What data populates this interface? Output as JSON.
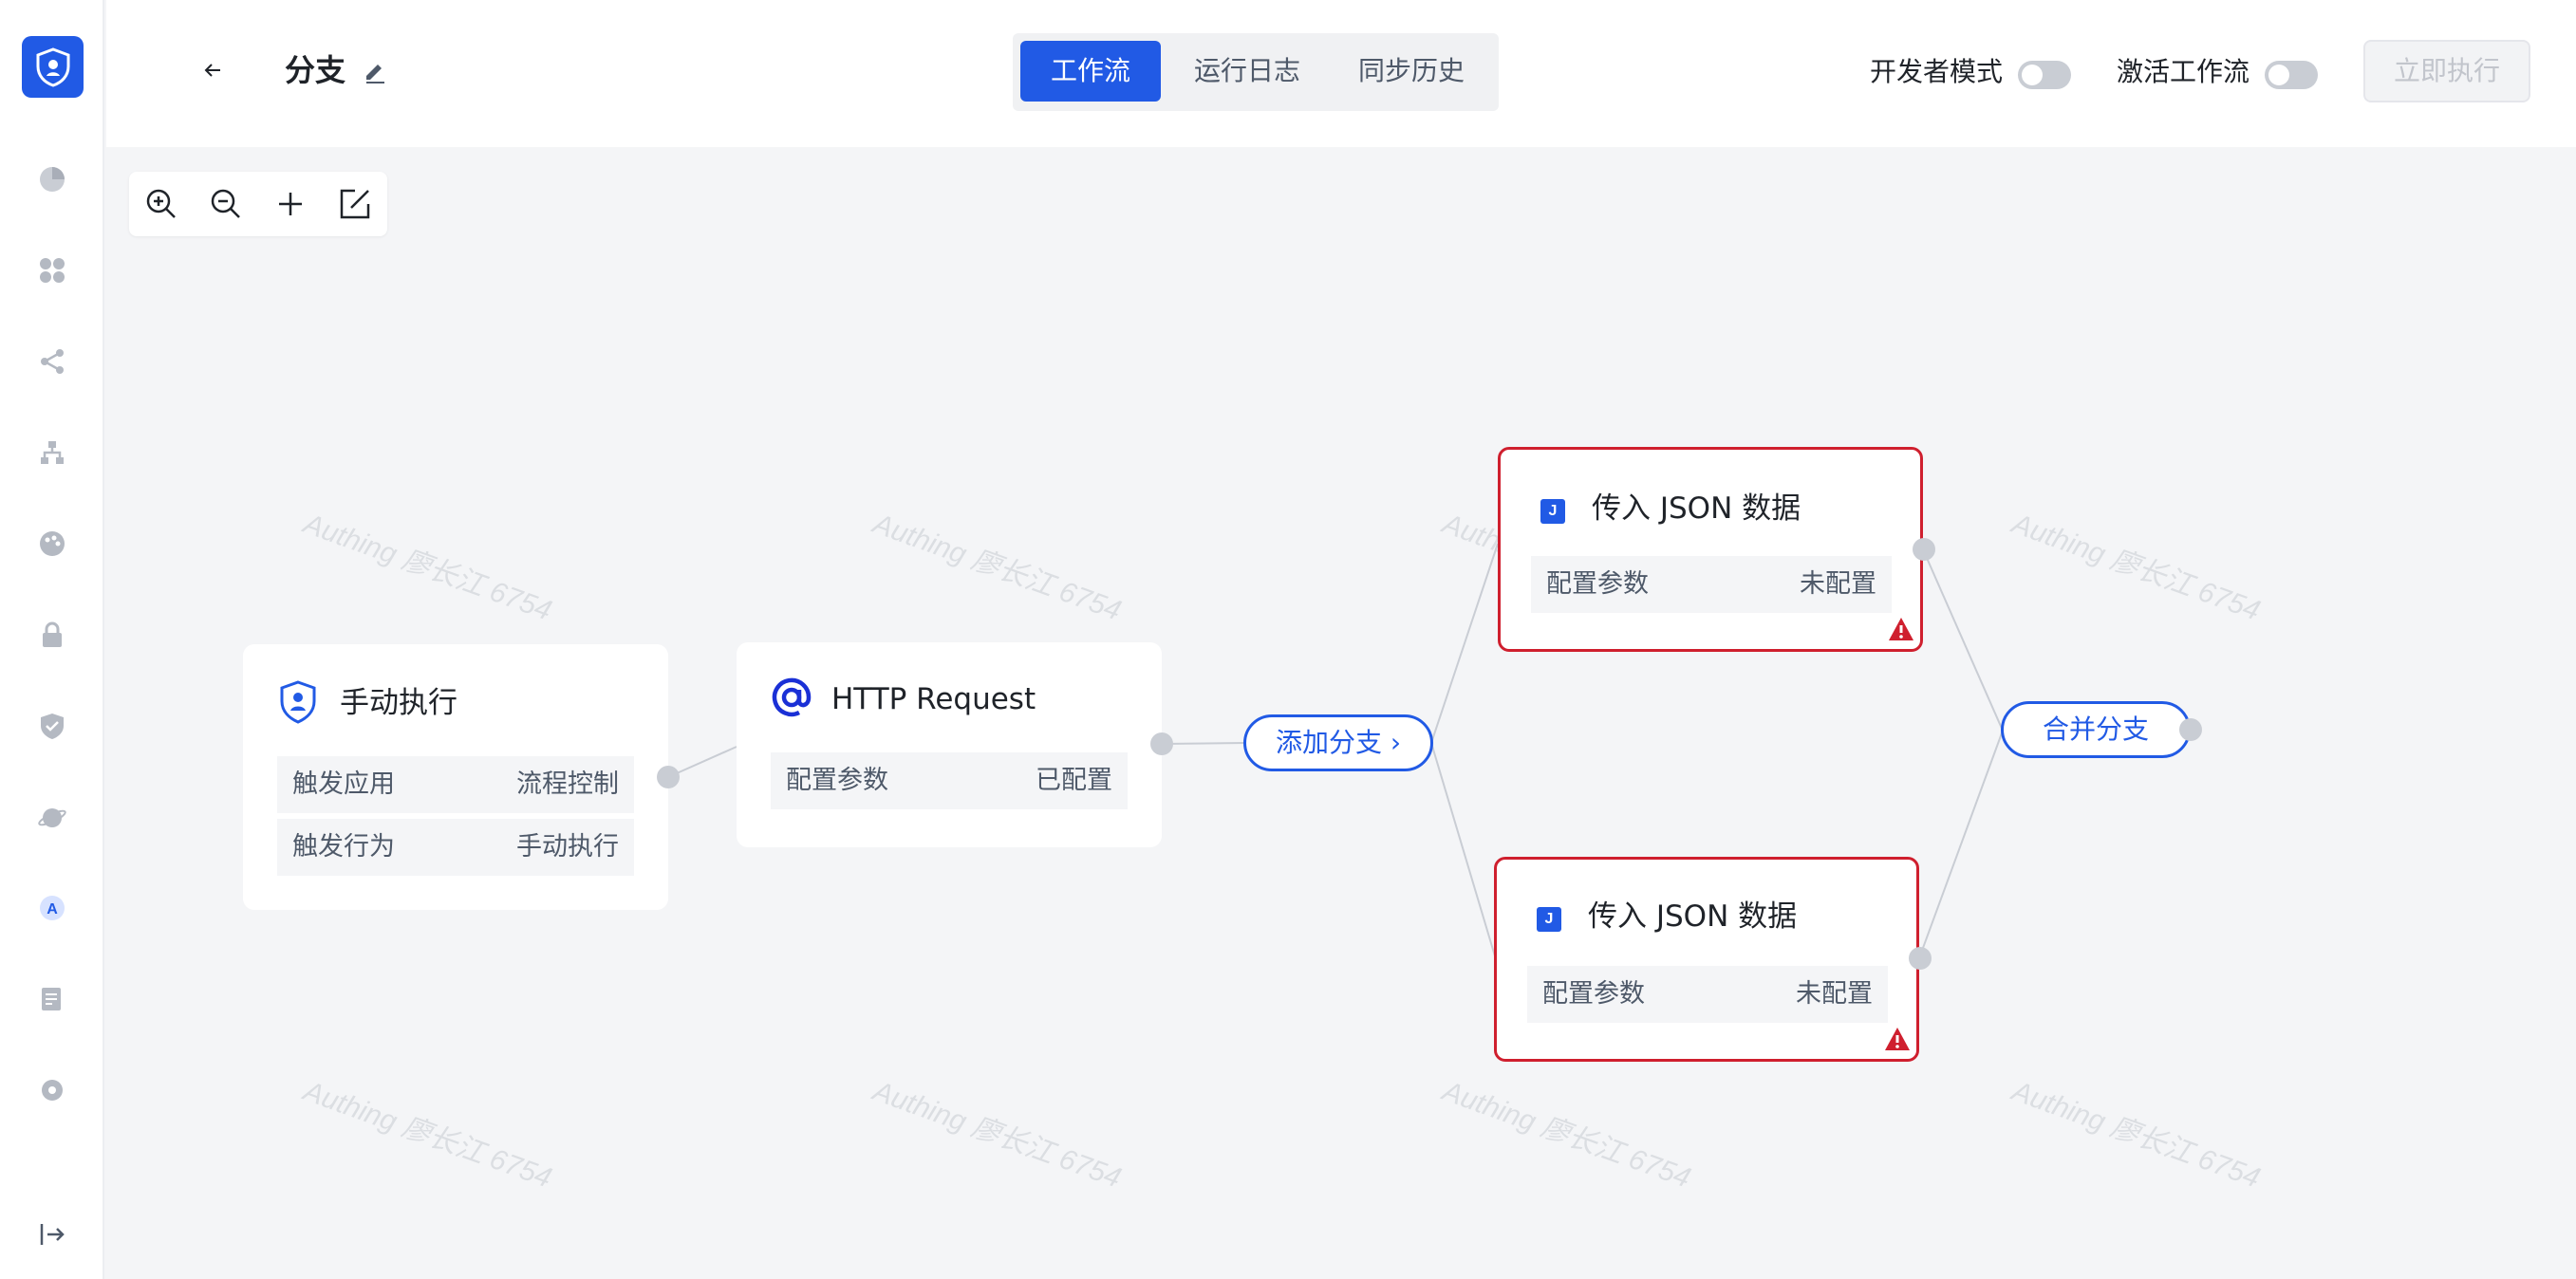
{
  "header": {
    "title": "分支",
    "tabs": [
      {
        "label": "工作流",
        "active": true
      },
      {
        "label": "运行日志",
        "active": false
      },
      {
        "label": "同步历史",
        "active": false
      }
    ],
    "dev_mode_label": "开发者模式",
    "activate_label": "激活工作流",
    "run_button": "立即执行"
  },
  "sidebar": {
    "icons": [
      "pie-chart-icon",
      "apps-icon",
      "share-icon",
      "org-tree-icon",
      "palette-icon",
      "lock-icon",
      "shield-check-icon",
      "planet-icon",
      "a-circle-icon",
      "document-icon",
      "gear-icon",
      "exit-icon"
    ]
  },
  "watermark": "Authing 廖长江 6754",
  "nodes": {
    "trigger": {
      "title": "手动执行",
      "rows": [
        {
          "key": "触发应用",
          "value": "流程控制"
        },
        {
          "key": "触发行为",
          "value": "手动执行"
        }
      ]
    },
    "http": {
      "title": "HTTP Request",
      "rows": [
        {
          "key": "配置参数",
          "value": "已配置"
        }
      ]
    },
    "add_branch": "添加分支 ›",
    "json1": {
      "title": "传入 JSON 数据",
      "icon_letter": "J",
      "rows": [
        {
          "key": "配置参数",
          "value": "未配置"
        }
      ]
    },
    "json2": {
      "title": "传入 JSON 数据",
      "icon_letter": "J",
      "rows": [
        {
          "key": "配置参数",
          "value": "未配置"
        }
      ]
    },
    "merge_branch": "合并分支"
  },
  "colors": {
    "accent": "#215ae5",
    "error": "#cf1f2e",
    "background": "#f4f5f7"
  }
}
